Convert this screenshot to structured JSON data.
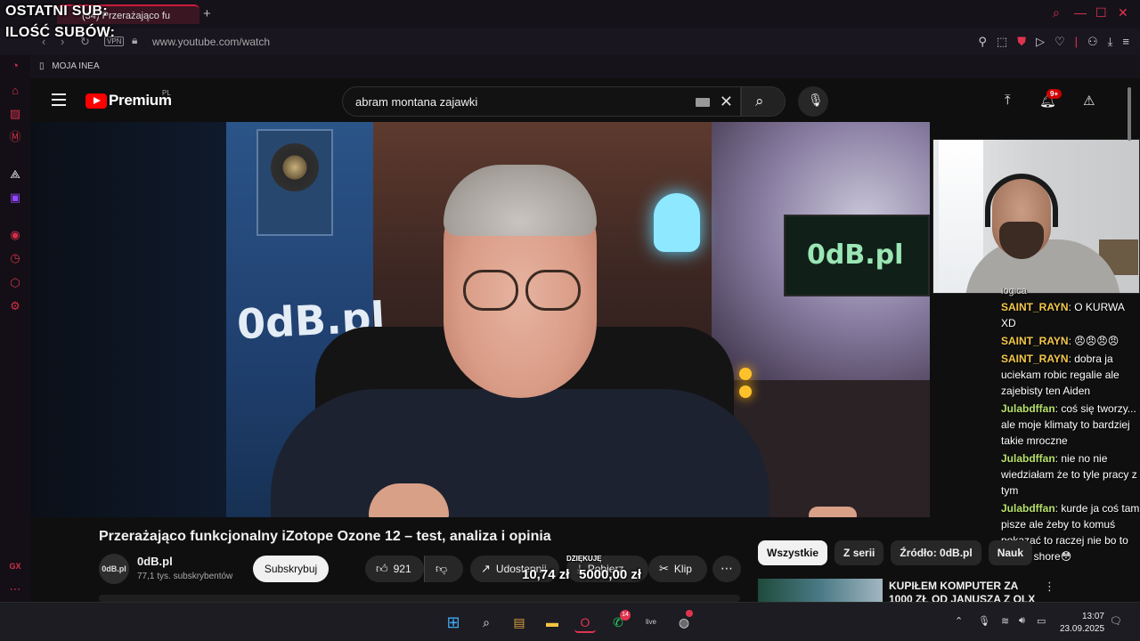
{
  "overlay": {
    "last_sub": "OSTATNI SUB:",
    "sub_count": "ILOŚĆ SUBÓW:"
  },
  "browser": {
    "tab_title": "(34) Przerażająco fu",
    "new_tab": "+",
    "vpn_label": "VPN",
    "url": "www.youtube.com/watch",
    "bookmark": "MOJA INEA",
    "accent": "#e0344e"
  },
  "youtube": {
    "logo_text": "Premium",
    "logo_region": "PL",
    "search_query": "abram montana zajawki",
    "notif_count": "9+"
  },
  "video": {
    "brand_text": "0dB.pl",
    "screen_text": "0dB.pl",
    "title": "Przerażająco funkcjonalny iZotope Ozone 12 – test, analiza i opinia",
    "channel_avatar": "0dB.pl",
    "channel_name": "0dB.pl",
    "channel_subs": "77,1 tys. subskrybentów",
    "subscribe": "Subskrybuj",
    "likes": "921",
    "share": "Udostępnij",
    "download": "Pobierz",
    "clip": "Klip",
    "more": "⋯"
  },
  "donation": {
    "label": "DZIĘKUJĘ",
    "amount_current": "10,74 zł",
    "amount_goal": "5000,00 zł"
  },
  "chips": [
    {
      "label": "Wszystkie",
      "active": true
    },
    {
      "label": "Z serii"
    },
    {
      "label": "Źródło: 0dB.pl"
    },
    {
      "label": "Nauk"
    }
  ],
  "recommendation": {
    "title": "KUPIŁEM KOMPUTER ZA 1000 ZŁ OD JANUSZA Z OLX"
  },
  "chat": {
    "partial_top": "logica",
    "messages": [
      {
        "user": "SAINT_RAYN",
        "text": " O KURWA XD",
        "color": "#f4c84a"
      },
      {
        "user": "SAINT_RAYN",
        "text": " 😠😠😠😠",
        "color": "#f4c84a"
      },
      {
        "user": "SAINT_RAYN",
        "text": " dobra ja uciekam robic regalie ale zajebisty ten Aiden",
        "color": "#f4c84a"
      },
      {
        "user": "Julabdffan",
        "text": " coś się tworzy... ale moje klimaty to bardziej takie mroczne",
        "color": "#b7e16a"
      },
      {
        "user": "Julabdffan",
        "text": " nie no nie wiedziałam że to tyle pracy z tym",
        "color": "#b7e16a"
      },
      {
        "user": "Julabdffan",
        "text": " kurde ja coś tam pisze ale żeby to komuś pokazać to raczej nie bo to trochę shore😳",
        "color": "#b7e16a"
      }
    ]
  },
  "taskbar": {
    "time": "13:07",
    "date": "23.09.2025",
    "whatsapp_badge": "14",
    "live_label": "live"
  }
}
